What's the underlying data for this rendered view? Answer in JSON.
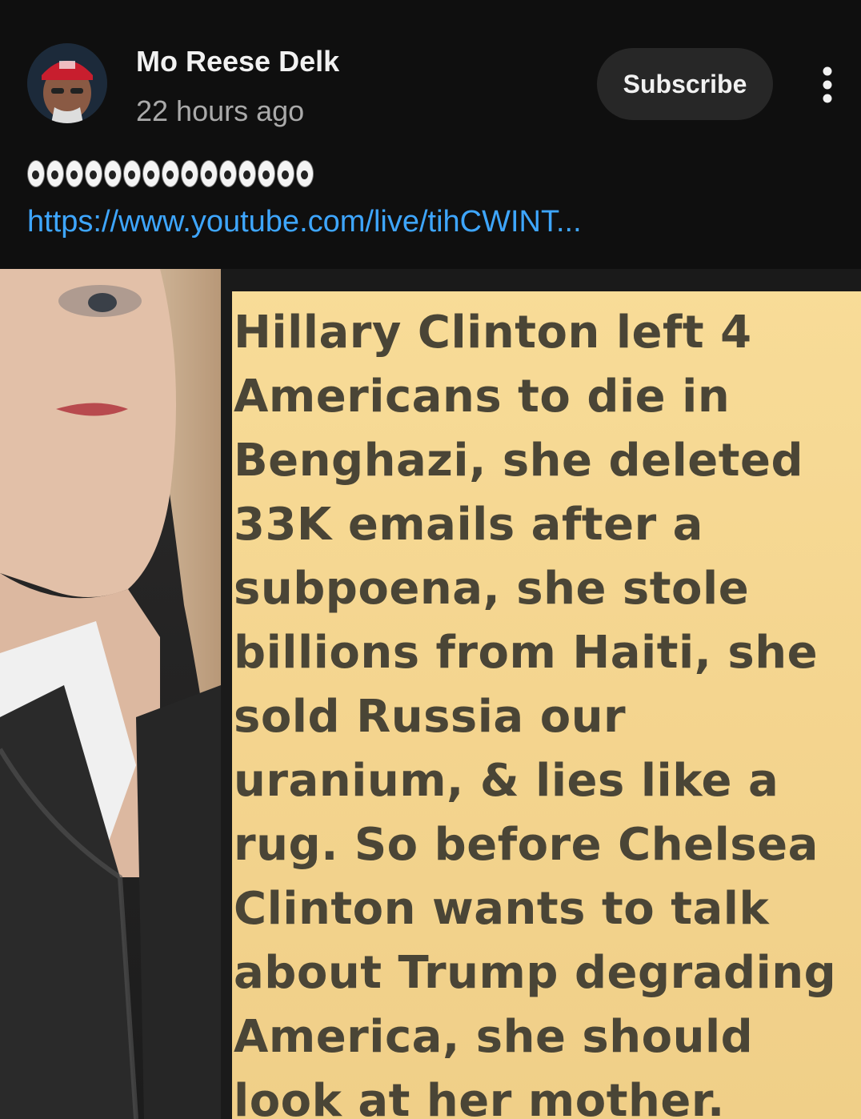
{
  "post": {
    "author": "Mo Reese Delk",
    "time": "22 hours ago",
    "subscribe_label": "Subscribe",
    "eye_emoji_count": 15,
    "link_text": "https://www.youtube.com/live/tihCWINT..."
  },
  "image_text": {
    "lines": [
      "Hillary Clinton left 4",
      "Americans to die in",
      "Benghazi, she deleted",
      "33K emails after a",
      "subpoena, she stole",
      "billions from Haiti, she",
      "sold Russia our",
      "uranium, & lies like a",
      "rug. So before Chelsea",
      "Clinton wants to talk",
      "about Trump degrading",
      "America, she should",
      "look at her mother."
    ]
  },
  "icons": {
    "more": "vertical-dots-icon",
    "eyes": "eyes-emoji-icon"
  },
  "colors": {
    "background": "#0f0f0f",
    "link": "#3ea6ff",
    "subscribe_bg": "#272727",
    "panel": "#f6d893"
  }
}
